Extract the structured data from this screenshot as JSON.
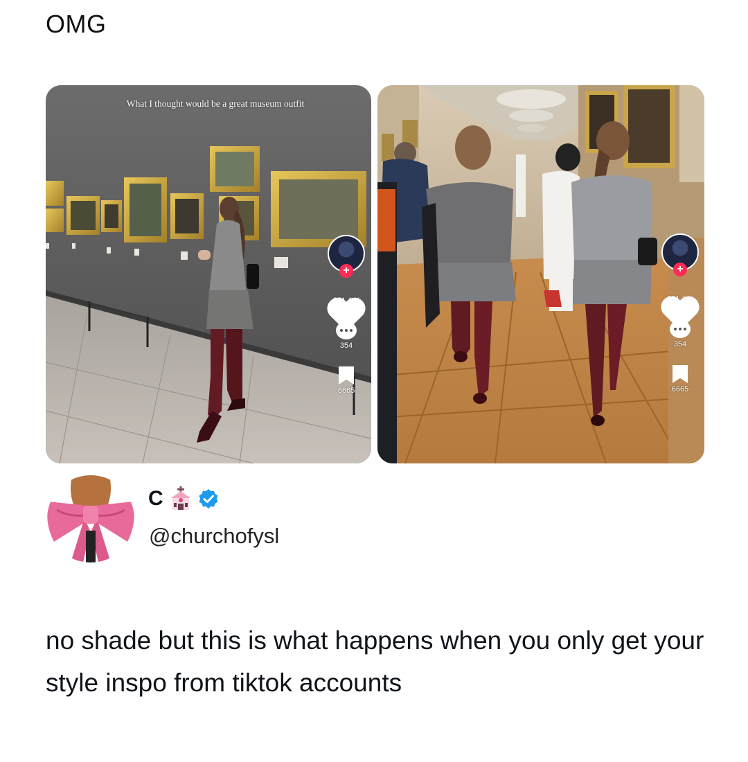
{
  "caption": "OMG",
  "left_image": {
    "overlay_text": "What I thought would be a great museum outfit",
    "likes": "351,1 K",
    "comments": "354",
    "saves": "6665"
  },
  "right_image": {
    "likes": "351,1 K",
    "comments": "354",
    "saves": "6665"
  },
  "author": {
    "display_name": "C",
    "handle": "@churchofysl",
    "verified": true
  },
  "tweet": {
    "text": "no shade but this is what happens when you only get your style inspo from tiktok accounts"
  },
  "colors": {
    "text": "#0f1419",
    "verified": "#1d9bf0",
    "tiktok_red": "#fe2c55"
  },
  "icons": [
    "church-icon",
    "verified-badge-icon",
    "heart-icon",
    "comment-icon",
    "bookmark-icon",
    "plus-icon"
  ]
}
